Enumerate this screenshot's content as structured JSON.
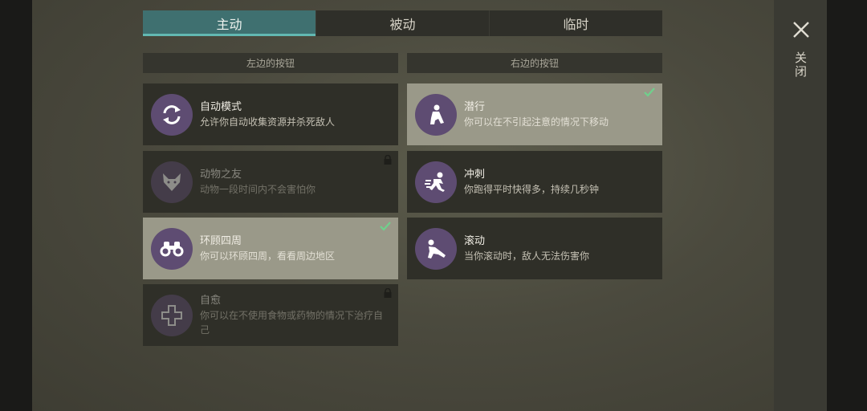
{
  "tabs": [
    {
      "label": "主动",
      "active": true
    },
    {
      "label": "被动",
      "active": false
    },
    {
      "label": "临时",
      "active": false
    }
  ],
  "columns": {
    "left_header": "左边的按钮",
    "right_header": "右边的按钮"
  },
  "left_cards": [
    {
      "title": "自动模式",
      "desc": "允许你自动收集资源并杀死敌人",
      "icon": "refresh-icon",
      "state": "normal"
    },
    {
      "title": "动物之友",
      "desc": "动物一段时间内不会害怕你",
      "icon": "fox-icon",
      "state": "locked"
    },
    {
      "title": "环顾四周",
      "desc": "你可以环顾四周，看看周边地区",
      "icon": "binoculars-icon",
      "state": "selected"
    },
    {
      "title": "自愈",
      "desc": "你可以在不使用食物或药物的情况下治疗自己",
      "icon": "plus-icon",
      "state": "locked"
    }
  ],
  "right_cards": [
    {
      "title": "潜行",
      "desc": "你可以在不引起注意的情况下移动",
      "icon": "sneak-icon",
      "state": "selected"
    },
    {
      "title": "冲刺",
      "desc": "你跑得平时快得多，持续几秒钟",
      "icon": "sprint-icon",
      "state": "normal"
    },
    {
      "title": "滚动",
      "desc": "当你滚动时，敌人无法伤害你",
      "icon": "roll-icon",
      "state": "normal"
    }
  ],
  "close": {
    "label": "关闭",
    "icon": "close-icon"
  },
  "colors": {
    "accent": "#3f7070",
    "accent_line": "#62b8b2",
    "icon_bg": "#5e4c72",
    "check": "#6fd08c"
  }
}
